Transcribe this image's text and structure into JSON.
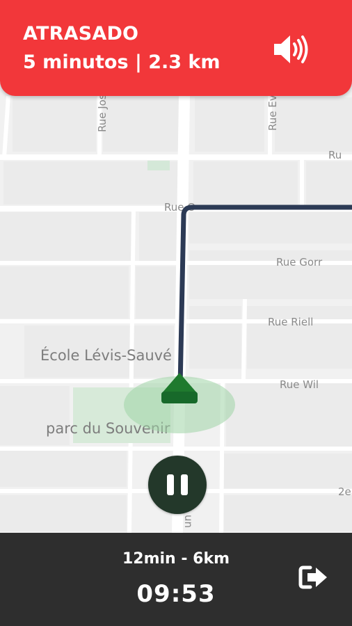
{
  "banner": {
    "status": "ATRASADO",
    "detail": "5 minutos | 2.3 km",
    "background_color": "#f2373a",
    "volume_icon": "volume-icon"
  },
  "map": {
    "streets": {
      "jos": "Rue Jos",
      "eve": "Rue Eve",
      "ru": "Ru",
      "rue_top": "Rue O",
      "gorr": "Rue Gorr",
      "riell": "Rue Riell",
      "wil": "Rue Wil",
      "ne": "2e"
    },
    "poi": {
      "school": "École Lévis-Sauvé",
      "park": "parc du Souvenir"
    },
    "route_color": "#2c3a55",
    "position_marker_color": "#1f7a2e"
  },
  "controls": {
    "pause_icon": "pause-icon"
  },
  "footer": {
    "trip_summary": "12min - 6km",
    "clock": "09:53",
    "exit_icon": "exit-icon"
  }
}
